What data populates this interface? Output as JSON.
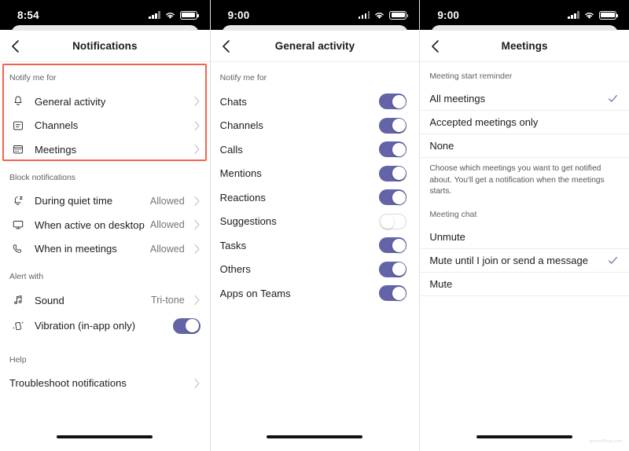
{
  "accent": {
    "toggle_on": "#6264a7",
    "check": "#6264a7",
    "highlight": "#f4634f"
  },
  "panels": [
    {
      "status": {
        "time": "8:54"
      },
      "nav": {
        "title": "Notifications",
        "back": "back-chevron"
      },
      "sections": [
        {
          "label": "Notify me for",
          "highlighted": true,
          "rows": [
            {
              "icon": "bell-icon",
              "label": "General activity",
              "accessory": "chevron"
            },
            {
              "icon": "channel-icon",
              "label": "Channels",
              "accessory": "chevron"
            },
            {
              "icon": "calendar-icon",
              "label": "Meetings",
              "accessory": "chevron"
            }
          ]
        },
        {
          "label": "Block notifications",
          "rows": [
            {
              "icon": "quiet-time-icon",
              "label": "During quiet time",
              "value": "Allowed",
              "accessory": "chevron"
            },
            {
              "icon": "desktop-icon",
              "label": "When active on desktop",
              "value": "Allowed",
              "accessory": "chevron"
            },
            {
              "icon": "phone-icon",
              "label": "When in meetings",
              "value": "Allowed",
              "accessory": "chevron"
            }
          ]
        },
        {
          "label": "Alert with",
          "rows": [
            {
              "icon": "music-note-icon",
              "label": "Sound",
              "value": "Tri-tone",
              "accessory": "chevron"
            },
            {
              "icon": "vibration-icon",
              "label": "Vibration (in-app only)",
              "accessory": "toggle",
              "toggle": "on"
            }
          ]
        },
        {
          "label": "Help",
          "rows": [
            {
              "icon": "",
              "label": "Troubleshoot notifications",
              "accessory": "chevron"
            }
          ]
        }
      ]
    },
    {
      "status": {
        "time": "9:00"
      },
      "nav": {
        "title": "General activity",
        "back": "back-chevron"
      },
      "sections": [
        {
          "label": "Notify me for",
          "rows": [
            {
              "label": "Chats",
              "accessory": "toggle",
              "toggle": "on"
            },
            {
              "label": "Channels",
              "accessory": "toggle",
              "toggle": "on"
            },
            {
              "label": "Calls",
              "accessory": "toggle",
              "toggle": "on"
            },
            {
              "label": "Mentions",
              "accessory": "toggle",
              "toggle": "on"
            },
            {
              "label": "Reactions",
              "accessory": "toggle",
              "toggle": "on"
            },
            {
              "label": "Suggestions",
              "accessory": "toggle",
              "toggle": "off"
            },
            {
              "label": "Tasks",
              "accessory": "toggle",
              "toggle": "on"
            },
            {
              "label": "Others",
              "accessory": "toggle",
              "toggle": "on"
            },
            {
              "label": "Apps on Teams",
              "accessory": "toggle",
              "toggle": "on"
            }
          ]
        }
      ]
    },
    {
      "status": {
        "time": "9:00"
      },
      "nav": {
        "title": "Meetings",
        "back": "back-chevron"
      },
      "groups": [
        {
          "label": "Meeting start reminder",
          "options": [
            {
              "label": "All meetings",
              "selected": true
            },
            {
              "label": "Accepted meetings only",
              "selected": false
            },
            {
              "label": "None",
              "selected": false
            }
          ],
          "description": "Choose which meetings you want to get notified about. You'll get a notification when the meetings starts."
        },
        {
          "label": "Meeting chat",
          "options": [
            {
              "label": "Unmute",
              "selected": false
            },
            {
              "label": "Mute until I join or send a message",
              "selected": true
            },
            {
              "label": "Mute",
              "selected": false
            }
          ]
        }
      ]
    }
  ],
  "watermark": "groovyPost.com"
}
